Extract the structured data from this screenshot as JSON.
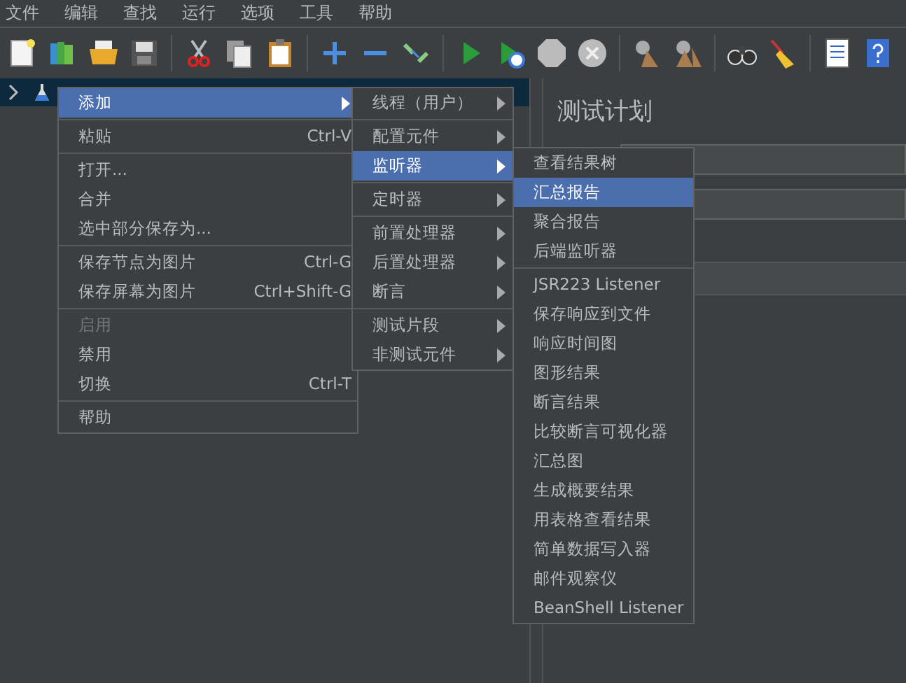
{
  "menubar": [
    "文件",
    "编辑",
    "查找",
    "运行",
    "选项",
    "工具",
    "帮助"
  ],
  "content": {
    "title": "测试计划"
  },
  "menus": [
    {
      "items": [
        {
          "kind": "item",
          "label": "添加",
          "submenu": true,
          "selected": true,
          "disabled": false
        },
        {
          "kind": "separator"
        },
        {
          "kind": "item",
          "label": "粘贴",
          "shortcut": "Ctrl-V",
          "submenu": false,
          "selected": false,
          "disabled": false
        },
        {
          "kind": "separator"
        },
        {
          "kind": "item",
          "label": "打开...",
          "submenu": false,
          "selected": false,
          "disabled": false
        },
        {
          "kind": "item",
          "label": "合并",
          "submenu": false,
          "selected": false,
          "disabled": false
        },
        {
          "kind": "item",
          "label": "选中部分保存为...",
          "submenu": false,
          "selected": false,
          "disabled": false
        },
        {
          "kind": "separator"
        },
        {
          "kind": "item",
          "label": "保存节点为图片",
          "shortcut": "Ctrl-G",
          "submenu": false,
          "selected": false,
          "disabled": false
        },
        {
          "kind": "item",
          "label": "保存屏幕为图片",
          "shortcut": "Ctrl+Shift-G",
          "submenu": false,
          "selected": false,
          "disabled": false
        },
        {
          "kind": "separator"
        },
        {
          "kind": "item",
          "label": "启用",
          "submenu": false,
          "selected": false,
          "disabled": true
        },
        {
          "kind": "item",
          "label": "禁用",
          "submenu": false,
          "selected": false,
          "disabled": false
        },
        {
          "kind": "item",
          "label": "切换",
          "shortcut": "Ctrl-T",
          "submenu": false,
          "selected": false,
          "disabled": false
        },
        {
          "kind": "separator"
        },
        {
          "kind": "item",
          "label": "帮助",
          "submenu": false,
          "selected": false,
          "disabled": false
        }
      ]
    },
    {
      "items": [
        {
          "kind": "item",
          "label": "线程（用户）",
          "submenu": true,
          "selected": false,
          "disabled": false
        },
        {
          "kind": "separator"
        },
        {
          "kind": "item",
          "label": "配置元件",
          "submenu": true,
          "selected": false,
          "disabled": false
        },
        {
          "kind": "item",
          "label": "监听器",
          "submenu": true,
          "selected": true,
          "disabled": false
        },
        {
          "kind": "separator"
        },
        {
          "kind": "item",
          "label": "定时器",
          "submenu": true,
          "selected": false,
          "disabled": false
        },
        {
          "kind": "separator"
        },
        {
          "kind": "item",
          "label": "前置处理器",
          "submenu": true,
          "selected": false,
          "disabled": false
        },
        {
          "kind": "item",
          "label": "后置处理器",
          "submenu": true,
          "selected": false,
          "disabled": false
        },
        {
          "kind": "item",
          "label": "断言",
          "submenu": true,
          "selected": false,
          "disabled": false
        },
        {
          "kind": "separator"
        },
        {
          "kind": "item",
          "label": "测试片段",
          "submenu": true,
          "selected": false,
          "disabled": false
        },
        {
          "kind": "item",
          "label": "非测试元件",
          "submenu": true,
          "selected": false,
          "disabled": false
        }
      ]
    },
    {
      "items": [
        {
          "kind": "item",
          "label": "查看结果树",
          "submenu": false,
          "selected": false,
          "disabled": false
        },
        {
          "kind": "item",
          "label": "汇总报告",
          "submenu": false,
          "selected": true,
          "disabled": false
        },
        {
          "kind": "item",
          "label": "聚合报告",
          "submenu": false,
          "selected": false,
          "disabled": false
        },
        {
          "kind": "item",
          "label": "后端监听器",
          "submenu": false,
          "selected": false,
          "disabled": false
        },
        {
          "kind": "separator"
        },
        {
          "kind": "item",
          "label": "JSR223 Listener",
          "submenu": false,
          "selected": false,
          "disabled": false
        },
        {
          "kind": "item",
          "label": "保存响应到文件",
          "submenu": false,
          "selected": false,
          "disabled": false
        },
        {
          "kind": "item",
          "label": "响应时间图",
          "submenu": false,
          "selected": false,
          "disabled": false
        },
        {
          "kind": "item",
          "label": "图形结果",
          "submenu": false,
          "selected": false,
          "disabled": false
        },
        {
          "kind": "item",
          "label": "断言结果",
          "submenu": false,
          "selected": false,
          "disabled": false
        },
        {
          "kind": "item",
          "label": "比较断言可视化器",
          "submenu": false,
          "selected": false,
          "disabled": false
        },
        {
          "kind": "item",
          "label": "汇总图",
          "submenu": false,
          "selected": false,
          "disabled": false
        },
        {
          "kind": "item",
          "label": "生成概要结果",
          "submenu": false,
          "selected": false,
          "disabled": false
        },
        {
          "kind": "item",
          "label": "用表格查看结果",
          "submenu": false,
          "selected": false,
          "disabled": false
        },
        {
          "kind": "item",
          "label": "简单数据写入器",
          "submenu": false,
          "selected": false,
          "disabled": false
        },
        {
          "kind": "item",
          "label": "邮件观察仪",
          "submenu": false,
          "selected": false,
          "disabled": false
        },
        {
          "kind": "item",
          "label": "BeanShell Listener",
          "submenu": false,
          "selected": false,
          "disabled": false
        }
      ]
    }
  ]
}
